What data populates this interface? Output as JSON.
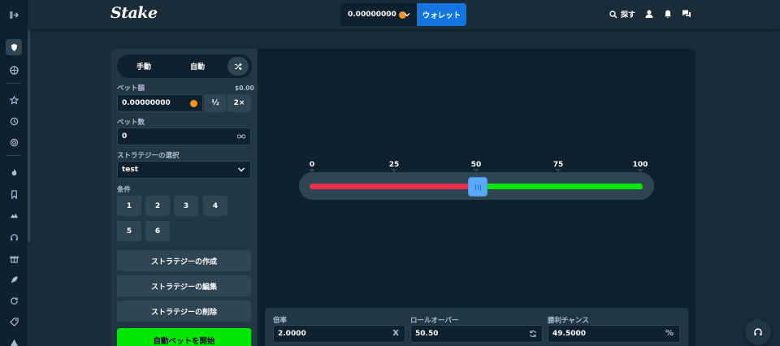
{
  "colors": {
    "accent": "#1475e1",
    "green": "#00e701",
    "red": "#ed2f4c",
    "bg": "#1a2c38",
    "panel": "#0f212e",
    "sidebar": "#213743"
  },
  "header": {
    "logo": "Stake",
    "balance": "0.00000000",
    "wallet_label": "ウォレット",
    "search_label": "探す"
  },
  "modes": {
    "manual": "手動",
    "auto": "自動"
  },
  "bet": {
    "label": "ベット額",
    "usd": "$0.00",
    "value": "0.00000000",
    "half": "½",
    "double": "2×"
  },
  "count": {
    "label": "ベット数",
    "value": "0"
  },
  "strategy": {
    "label": "ストラテジーの選択",
    "selected": "test"
  },
  "conditions": {
    "label": "条件",
    "buttons": [
      "1",
      "2",
      "3",
      "4",
      "5",
      "6"
    ]
  },
  "actions": {
    "create": "ストラテジーの作成",
    "edit": "ストラテジーの編集",
    "delete": "ストラテジーの削除",
    "start": "自動ベットを開始"
  },
  "slider": {
    "ticks": [
      "0",
      "25",
      "50",
      "75",
      "100"
    ],
    "value": 50.5
  },
  "stats": {
    "multiplier": {
      "label": "倍率",
      "value": "2.0000",
      "suffix": "X"
    },
    "rollover": {
      "label": "ロールオーバー",
      "value": "50.50"
    },
    "win_chance": {
      "label": "勝利チャンス",
      "value": "49.5000",
      "suffix": "%"
    }
  }
}
